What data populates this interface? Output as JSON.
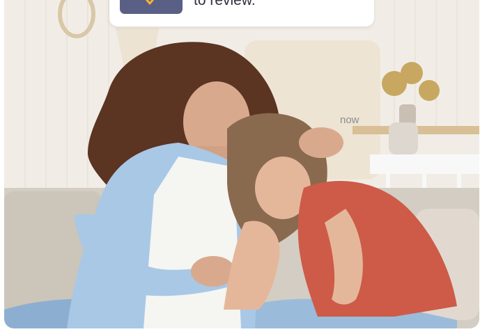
{
  "notification": {
    "text": "to review.",
    "time": "now",
    "icon": "app-badge-icon",
    "accent": "#5a5f86",
    "glyph_color": "#f3b43a"
  },
  "photo": {
    "icon": "photo-image"
  }
}
